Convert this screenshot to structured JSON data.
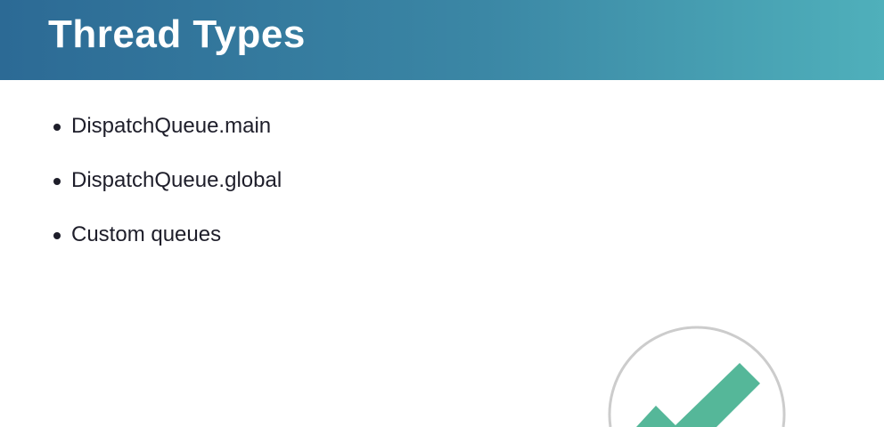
{
  "slide": {
    "title": "Thread Types",
    "bullets": [
      "DispatchQueue.main",
      "DispatchQueue.global",
      "Custom queues"
    ]
  },
  "colors": {
    "header_start": "#2c6a95",
    "header_end": "#4fb0bb",
    "check": "#55b799",
    "circle": "#cccccc"
  },
  "icons": {
    "badge": "checkmark-icon"
  }
}
